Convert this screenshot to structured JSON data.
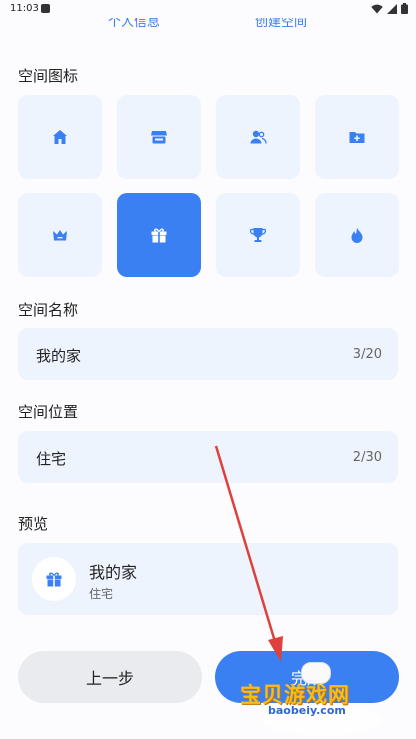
{
  "status_bar": {
    "time": "11:03"
  },
  "steps": [
    {
      "label": "个人信息"
    },
    {
      "label": "创建空间"
    }
  ],
  "icon_section": {
    "label": "空间图标",
    "icons": [
      {
        "name": "home-icon",
        "selected": false
      },
      {
        "name": "store-icon",
        "selected": false
      },
      {
        "name": "people-icon",
        "selected": false
      },
      {
        "name": "folder-add-icon",
        "selected": false
      },
      {
        "name": "crown-icon",
        "selected": false
      },
      {
        "name": "gift-icon",
        "selected": true
      },
      {
        "name": "trophy-icon",
        "selected": false
      },
      {
        "name": "flame-icon",
        "selected": false
      }
    ]
  },
  "space_name": {
    "label": "空间名称",
    "value": "我的家",
    "count": "3/20"
  },
  "space_location": {
    "label": "空间位置",
    "value": "住宅",
    "count": "2/30"
  },
  "preview": {
    "label": "预览",
    "name": "我的家",
    "location": "住宅"
  },
  "buttons": {
    "prev": "上一步",
    "next": "完成"
  },
  "watermark": {
    "title": "宝贝游戏网",
    "url": "baobeiy.com"
  },
  "colors": {
    "accent": "#3a80f3",
    "cell_bg": "#eef4fd",
    "annotation": "#e0403c"
  }
}
